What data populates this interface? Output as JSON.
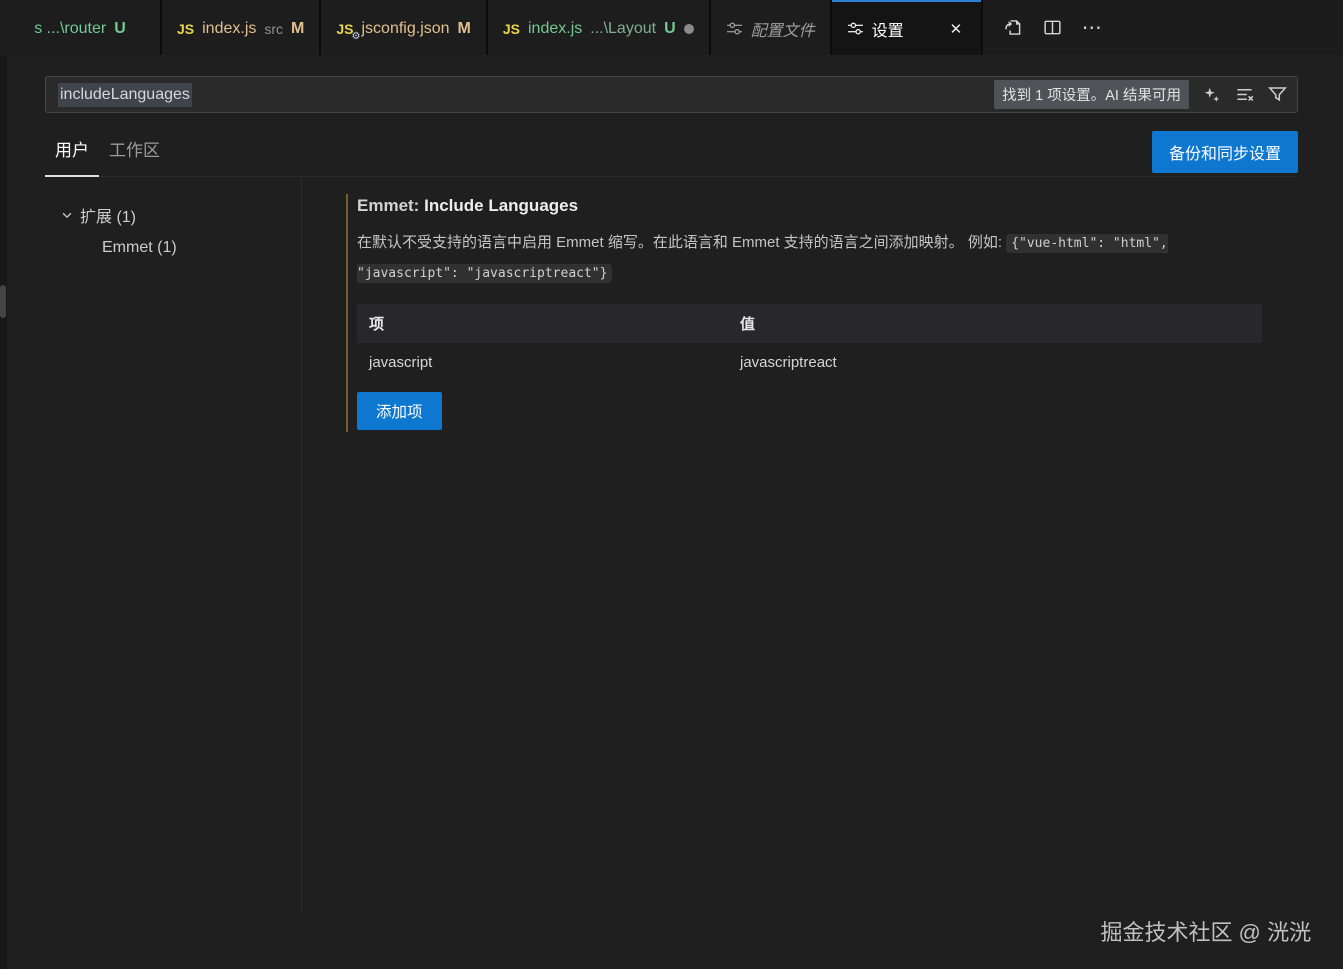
{
  "tabs": [
    {
      "label": "s ...\\router",
      "badge": "U"
    },
    {
      "icon": "JS",
      "label": "index.js",
      "desc": "src",
      "badge": "M"
    },
    {
      "icon": "JS",
      "label": "jsconfig.json",
      "badge": "M"
    },
    {
      "icon": "JS",
      "label": "index.js",
      "desc": "...\\Layout",
      "badge": "U"
    },
    {
      "icon": "settings-sliders",
      "label": "配置文件"
    },
    {
      "icon": "settings-sliders",
      "label": "设置"
    }
  ],
  "icons": {
    "close": "✕",
    "more": "⋯"
  },
  "editor_actions": [
    "open-settings-json",
    "split-editor",
    "more-actions"
  ],
  "search": {
    "value": "includeLanguages",
    "result_badge": "找到 1 项设置。AI 结果可用",
    "icons": [
      "ai-sparkle",
      "clear-search-results",
      "filter"
    ]
  },
  "scope_tabs": {
    "user": "用户",
    "workspace": "工作区"
  },
  "sync_button": "备份和同步设置",
  "toc": {
    "parent": "扩展 (1)",
    "child": "Emmet (1)"
  },
  "setting": {
    "category": "Emmet:",
    "name": "Include Languages",
    "description": "在默认不受支持的语言中启用 Emmet 缩写。在此语言和 Emmet 支持的语言之间添加映射。 例如: ",
    "example_code": "{\"vue-html\": \"html\", \"javascript\": \"javascriptreact\"}",
    "table": {
      "headers": {
        "key": "项",
        "value": "值"
      },
      "rows": [
        {
          "key": "javascript",
          "value": "javascriptreact"
        }
      ]
    },
    "add_button": "添加项"
  },
  "watermark": "掘金技术社区 @ 洸洸",
  "colors": {
    "accent_blue": "#0e78d0",
    "tab_active_border": "#2a81d6",
    "git_untracked_green": "#73c991",
    "git_modified_tan": "#e2c08d",
    "modified_indicator": "#7a5c28",
    "background": "#1f1f1f"
  }
}
